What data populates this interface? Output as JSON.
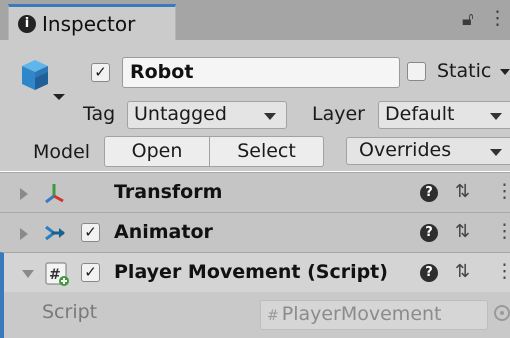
{
  "window": {
    "tab_title": "Inspector",
    "icons": [
      "info-icon",
      "lock-icon",
      "kebab-menu-icon"
    ]
  },
  "header": {
    "active": true,
    "name": "Robot",
    "static_label": "Static",
    "static_checked": false,
    "tag_label": "Tag",
    "tag_value": "Untagged",
    "layer_label": "Layer",
    "layer_value": "Default",
    "model_label": "Model",
    "open_button": "Open",
    "select_button": "Select",
    "overrides_value": "Overrides"
  },
  "components": [
    {
      "title": "Transform",
      "expanded": false,
      "has_checkbox": false,
      "icon": "transform-axes-icon"
    },
    {
      "title": "Animator",
      "expanded": false,
      "has_checkbox": true,
      "enabled": true,
      "icon": "animator-icon"
    },
    {
      "title": "Player Movement (Script)",
      "expanded": true,
      "has_checkbox": true,
      "enabled": true,
      "icon": "csharp-script-icon"
    }
  ],
  "script_field": {
    "label": "Script",
    "value": "PlayerMovement"
  },
  "colors": {
    "accent": "#3a79bb",
    "panel": "#cbcbcb",
    "tabbar": "#a5a5a5"
  }
}
